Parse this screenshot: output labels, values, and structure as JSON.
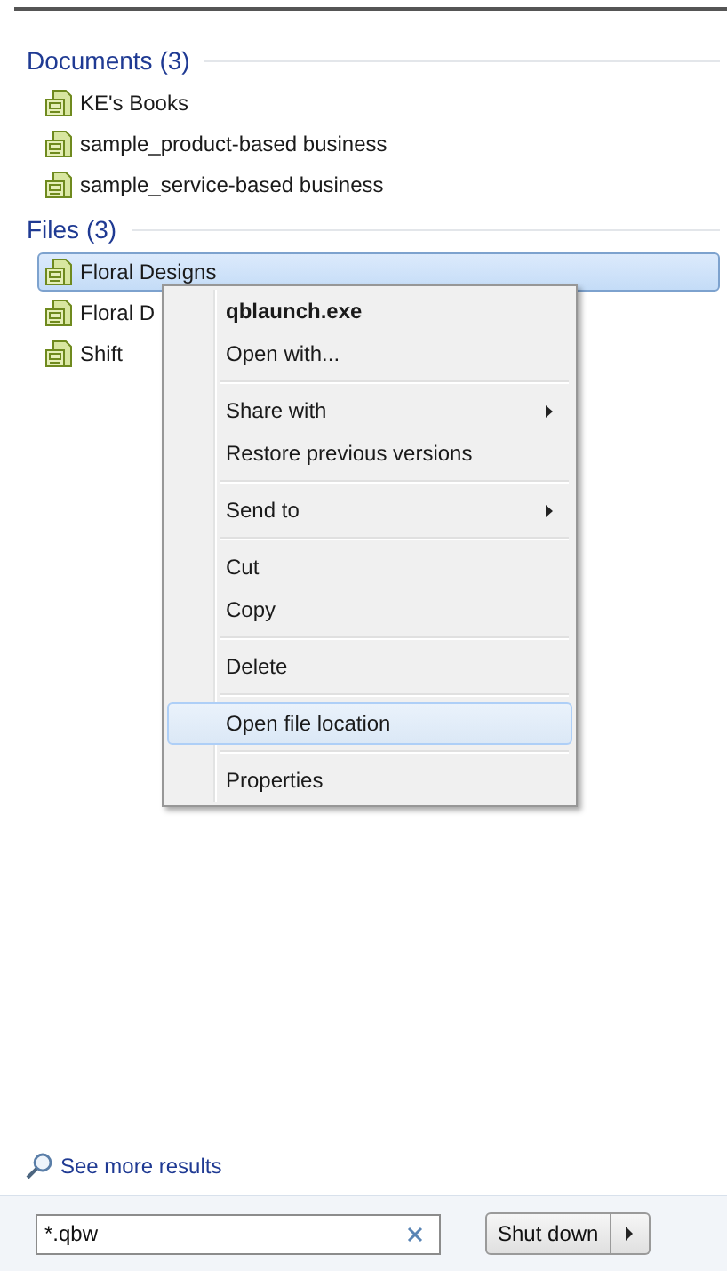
{
  "groups": [
    {
      "title": "Documents (3)",
      "items": [
        {
          "name": "KE's Books",
          "selected": false
        },
        {
          "name": "sample_product-based business",
          "selected": false
        },
        {
          "name": "sample_service-based business",
          "selected": false
        }
      ]
    },
    {
      "title": "Files (3)",
      "items": [
        {
          "name": "Floral Designs",
          "selected": true
        },
        {
          "name": "Floral D",
          "selected": false
        },
        {
          "name": "Shift",
          "selected": false
        }
      ]
    }
  ],
  "context_menu": [
    {
      "kind": "item",
      "label": "qblaunch.exe",
      "bold": true,
      "submenu": false,
      "selected": false
    },
    {
      "kind": "item",
      "label": "Open with...",
      "bold": false,
      "submenu": false,
      "selected": false
    },
    {
      "kind": "separator"
    },
    {
      "kind": "item",
      "label": "Share with",
      "bold": false,
      "submenu": true,
      "selected": false
    },
    {
      "kind": "item",
      "label": "Restore previous versions",
      "bold": false,
      "submenu": false,
      "selected": false
    },
    {
      "kind": "separator"
    },
    {
      "kind": "item",
      "label": "Send to",
      "bold": false,
      "submenu": true,
      "selected": false
    },
    {
      "kind": "separator"
    },
    {
      "kind": "item",
      "label": "Cut",
      "bold": false,
      "submenu": false,
      "selected": false
    },
    {
      "kind": "item",
      "label": "Copy",
      "bold": false,
      "submenu": false,
      "selected": false
    },
    {
      "kind": "separator"
    },
    {
      "kind": "item",
      "label": "Delete",
      "bold": false,
      "submenu": false,
      "selected": false
    },
    {
      "kind": "separator"
    },
    {
      "kind": "item",
      "label": "Open file location",
      "bold": false,
      "submenu": false,
      "selected": true
    },
    {
      "kind": "separator"
    },
    {
      "kind": "item",
      "label": "Properties",
      "bold": false,
      "submenu": false,
      "selected": false
    }
  ],
  "see_more": "See more results",
  "search": {
    "value": "*.qbw"
  },
  "shutdown": {
    "label": "Shut down"
  }
}
